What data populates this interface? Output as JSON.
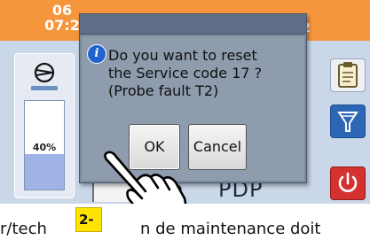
{
  "status_bar": {
    "time": "06\n07:2",
    "right_text": "2"
  },
  "left_panel": {
    "gauge_label": "40%",
    "gauge_level": 0.4
  },
  "bottom": {
    "mode_text": "PDP",
    "drop_glyph": "●"
  },
  "dialog": {
    "message_lines": [
      "Do you want to reset",
      "the Service code 17 ?",
      "(Probe fault T2)"
    ],
    "ok_label": "OK",
    "cancel_label": "Cancel"
  },
  "step_label": "2-",
  "caption": {
    "left": "r/tech",
    "right": "n de maintenance doit"
  },
  "colors": {
    "topbar": "#f5953c",
    "main_bg": "#c9d7e8",
    "dialog": "#7b8a9d",
    "power": "#d5322f",
    "filter": "#2c66b5",
    "step_label": "#ffe400"
  },
  "icons": [
    "compressor-icon",
    "clipboard-icon",
    "filter-icon",
    "power-icon",
    "info-icon",
    "pointing-hand-icon"
  ]
}
